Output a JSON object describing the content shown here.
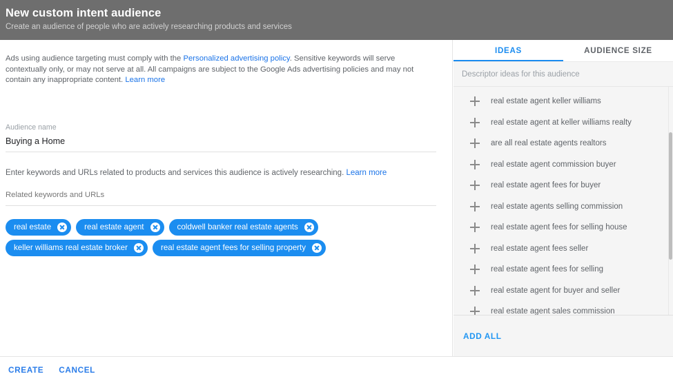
{
  "header": {
    "title": "New custom intent audience",
    "subtitle": "Create an audience of people who are actively researching products and services",
    "background_color": "#6e6e6e"
  },
  "policy_note": {
    "text_part_1": "Ads using audience targeting must comply with the ",
    "policy_link": "Personalized advertising policy",
    "text_part_2": ". Sensitive keywords will serve contextually only, or may not serve at all. All campaigns are subject to the Google Ads advertising policies and may not contain any inappropriate content. ",
    "learn_more": "Learn more"
  },
  "audience_name": {
    "label": "Audience name",
    "value": "Buying a Home",
    "placeholder": "Audience name"
  },
  "keywords_help": {
    "text": "Enter keywords and URLs related to products and services this audience is actively researching. ",
    "learn_more": "Learn more"
  },
  "related_keywords": {
    "label": "Related keywords and URLs",
    "chips": [
      "real estate",
      "real estate agent",
      "coldwell banker real estate agents",
      "keller williams real estate broker",
      "real estate agent fees for selling property"
    ],
    "remove_icon": "close-circle-icon",
    "chip_color": "#1b8df0"
  },
  "right_panel": {
    "tabs": [
      {
        "label": "IDEAS",
        "active": true
      },
      {
        "label": "AUDIENCE SIZE",
        "active": false
      }
    ],
    "subheader": "Descriptor ideas for this audience",
    "add_icon": "plus-icon",
    "ideas": [
      "real estate agent keller williams",
      "real estate agent at keller williams realty",
      "are all real estate agents realtors",
      "real estate agent commission buyer",
      "real estate agent fees for buyer",
      "real estate agents selling commission",
      "real estate agent fees for selling house",
      "real estate agent fees seller",
      "real estate agent fees for selling",
      "real estate agent for buyer and seller",
      "real estate agent sales commission"
    ],
    "add_all_label": "ADD ALL",
    "accent_color": "#2196f3"
  },
  "footer": {
    "create_label": "CREATE",
    "cancel_label": "CANCEL"
  }
}
